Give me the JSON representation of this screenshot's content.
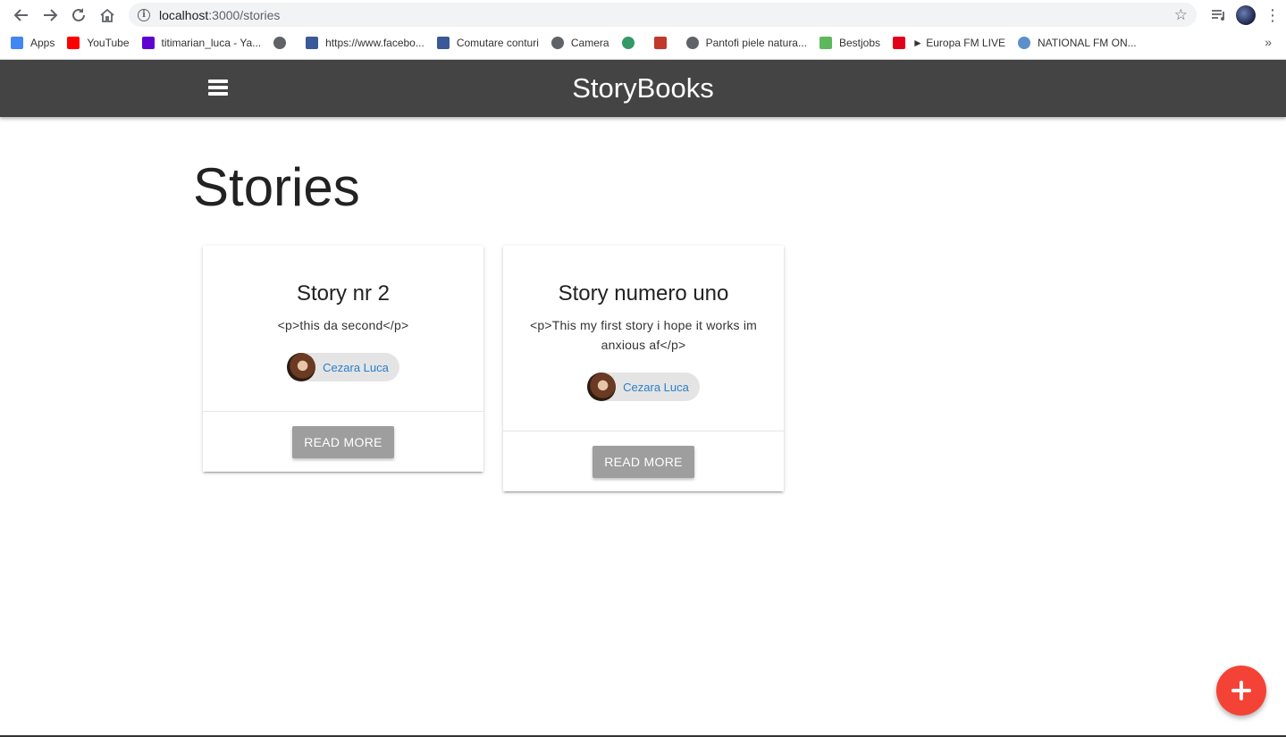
{
  "browser": {
    "url_host": "localhost",
    "url_path": ":3000/stories",
    "bookmarks": [
      {
        "label": "Apps",
        "icon": "apps-grid-icon",
        "color": "#4285f4"
      },
      {
        "label": "YouTube",
        "icon": "youtube-icon",
        "color": "#ff0000"
      },
      {
        "label": "titimarian_luca - Ya...",
        "icon": "yahoo-mail-icon",
        "color": "#6001d2"
      },
      {
        "label": "",
        "icon": "globe-icon",
        "color": "#5f6368"
      },
      {
        "label": "https://www.facebo...",
        "icon": "facebook-icon",
        "color": "#3b5998"
      },
      {
        "label": "Comutare conturi",
        "icon": "facebook-icon",
        "color": "#3b5998"
      },
      {
        "label": "Camera",
        "icon": "globe-icon",
        "color": "#5f6368"
      },
      {
        "label": "",
        "icon": "wikimedia-icon",
        "color": "#339966"
      },
      {
        "label": "",
        "icon": "flower-icon",
        "color": "#c0392b"
      },
      {
        "label": "Pantofi piele natura...",
        "icon": "globe-icon",
        "color": "#5f6368"
      },
      {
        "label": "Bestjobs",
        "icon": "bestjobs-icon",
        "color": "#5cb85c"
      },
      {
        "label": "► Europa FM LIVE",
        "icon": "europafm-icon",
        "color": "#e2001a"
      },
      {
        "label": "NATIONAL FM ON...",
        "icon": "play-circle-icon",
        "color": "#5b8fc9"
      }
    ],
    "more_bookmarks": "»"
  },
  "navbar": {
    "brand": "StoryBooks"
  },
  "page": {
    "title": "Stories"
  },
  "stories": [
    {
      "title": "Story nr 2",
      "body": "<p>this da second</p>",
      "author": "Cezara Luca",
      "button": "READ MORE"
    },
    {
      "title": "Story numero uno",
      "body": "<p>This my first story i hope it works im anxious af</p>",
      "author": "Cezara Luca",
      "button": "READ MORE"
    }
  ],
  "colors": {
    "navbar": "#444444",
    "fab": "#f44336",
    "button": "#9e9e9e",
    "link": "#2a7fc9"
  }
}
